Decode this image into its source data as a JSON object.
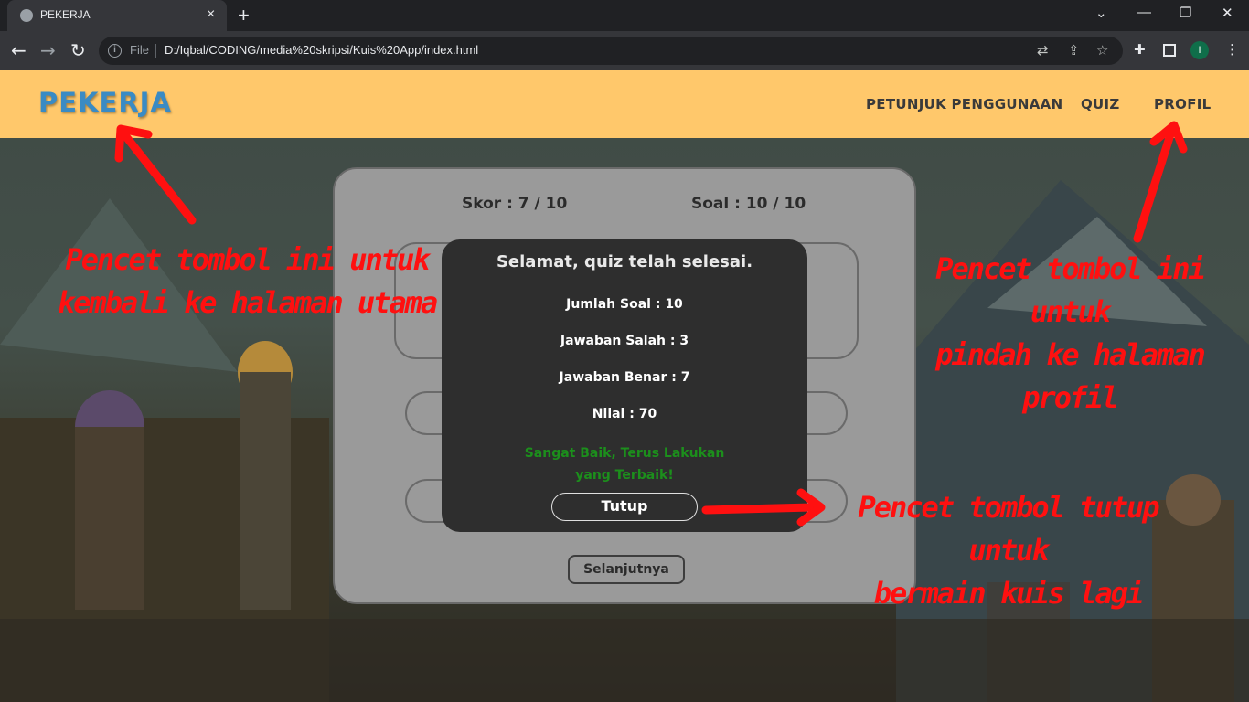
{
  "browser": {
    "tab_title": "PEKERJA",
    "tab_close": "×",
    "new_tab": "+",
    "file_label": "File",
    "url": "D:/Iqbal/CODING/media%20skripsi/Kuis%20App/index.html",
    "profile_initial": "I",
    "window_controls": {
      "dropdown": "⌄",
      "minimize": "—",
      "restore": "❐",
      "close": "✕"
    },
    "nav": {
      "back": "←",
      "forward": "→",
      "reload": "↻"
    },
    "icons": {
      "translate": "translate-icon",
      "share": "share-icon",
      "bookmark": "star-icon",
      "extensions": "puzzle-icon",
      "side_panel": "side-panel-icon",
      "menu": "kebab-menu-icon"
    }
  },
  "navbar": {
    "brand": "PEKERJA",
    "links": [
      "PETUNJUK PENGGUNAAN",
      "QUIZ",
      "PROFIL"
    ]
  },
  "quiz": {
    "score": "Skor : 7 / 10",
    "question_counter": "Soal : 10 / 10",
    "next_button": "Selanjutnya"
  },
  "modal": {
    "title": "Selamat, quiz telah selesai.",
    "total_questions": "Jumlah Soal : 10",
    "wrong_answers": "Jawaban Salah : 3",
    "correct_answers": "Jawaban Benar : 7",
    "grade": "Nilai : 70",
    "message": "Sangat Baik, Terus Lakukan yang Terbaik!",
    "close_button": "Tutup"
  },
  "annotations": {
    "home": [
      "Pencet tombol ini untuk",
      "kembali ke halaman utama"
    ],
    "profile": [
      "Pencet tombol ini untuk",
      "pindah ke halaman profil"
    ],
    "close": [
      "Pencet tombol tutup untuk",
      "bermain kuis lagi"
    ]
  },
  "colors": {
    "navbar": "#ffc86b",
    "brand": "#3a8bc4",
    "annotation": "#ff1010",
    "message": "#1c8f1c",
    "modal": "#2e2e2e",
    "card": "#9a9a9a"
  }
}
